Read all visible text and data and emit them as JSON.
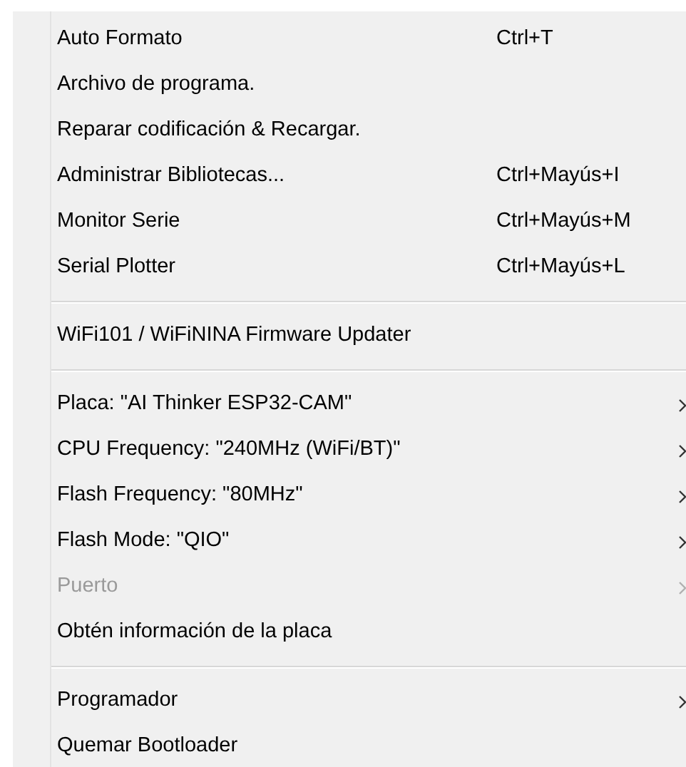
{
  "menu": {
    "groups": [
      {
        "items": [
          {
            "label": "Auto Formato",
            "shortcut": "Ctrl+T",
            "submenu": false,
            "disabled": false
          },
          {
            "label": "Archivo de programa.",
            "submenu": false,
            "disabled": false
          },
          {
            "label": "Reparar codificación & Recargar.",
            "submenu": false,
            "disabled": false
          },
          {
            "label": "Administrar Bibliotecas...",
            "shortcut": "Ctrl+Mayús+I",
            "submenu": false,
            "disabled": false
          },
          {
            "label": "Monitor Serie",
            "shortcut": "Ctrl+Mayús+M",
            "submenu": false,
            "disabled": false
          },
          {
            "label": "Serial Plotter",
            "shortcut": "Ctrl+Mayús+L",
            "submenu": false,
            "disabled": false
          }
        ]
      },
      {
        "items": [
          {
            "label": "WiFi101 / WiFiNINA Firmware Updater",
            "submenu": false,
            "disabled": false
          }
        ]
      },
      {
        "items": [
          {
            "label": "Placa: \"AI Thinker ESP32-CAM\"",
            "submenu": true,
            "disabled": false
          },
          {
            "label": "CPU Frequency: \"240MHz (WiFi/BT)\"",
            "submenu": true,
            "disabled": false
          },
          {
            "label": "Flash Frequency: \"80MHz\"",
            "submenu": true,
            "disabled": false
          },
          {
            "label": "Flash Mode: \"QIO\"",
            "submenu": true,
            "disabled": false
          },
          {
            "label": "Puerto",
            "submenu": true,
            "disabled": true
          },
          {
            "label": "Obtén información de la placa",
            "submenu": false,
            "disabled": false
          }
        ]
      },
      {
        "items": [
          {
            "label": "Programador",
            "submenu": true,
            "disabled": false
          },
          {
            "label": "Quemar Bootloader",
            "submenu": false,
            "disabled": false
          }
        ]
      }
    ]
  }
}
